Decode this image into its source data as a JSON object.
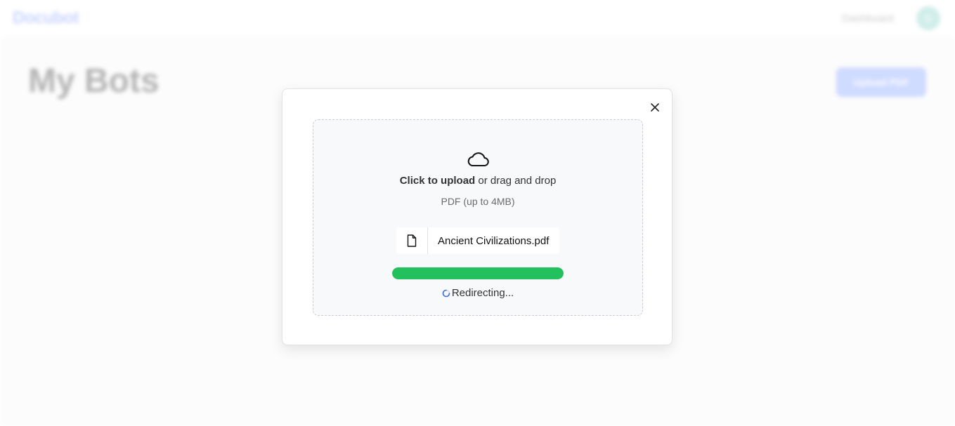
{
  "header": {
    "logo": "Docubot",
    "nav_link": "Dashboard",
    "avatar_initial": "D"
  },
  "main": {
    "title": "My Bots",
    "upload_button": "Upload PDF"
  },
  "modal": {
    "close_icon": "close-icon",
    "dropzone": {
      "icon": "cloud-icon",
      "upload_bold": "Click to upload",
      "upload_rest": " or drag and drop",
      "hint": "PDF (up to 4MB)"
    },
    "file": {
      "icon": "file-icon",
      "name": "Ancient Civilizations.pdf"
    },
    "progress": {
      "percent": 100,
      "color": "#22c15e"
    },
    "status": {
      "icon": "spinner-icon",
      "text": "Redirecting..."
    }
  }
}
